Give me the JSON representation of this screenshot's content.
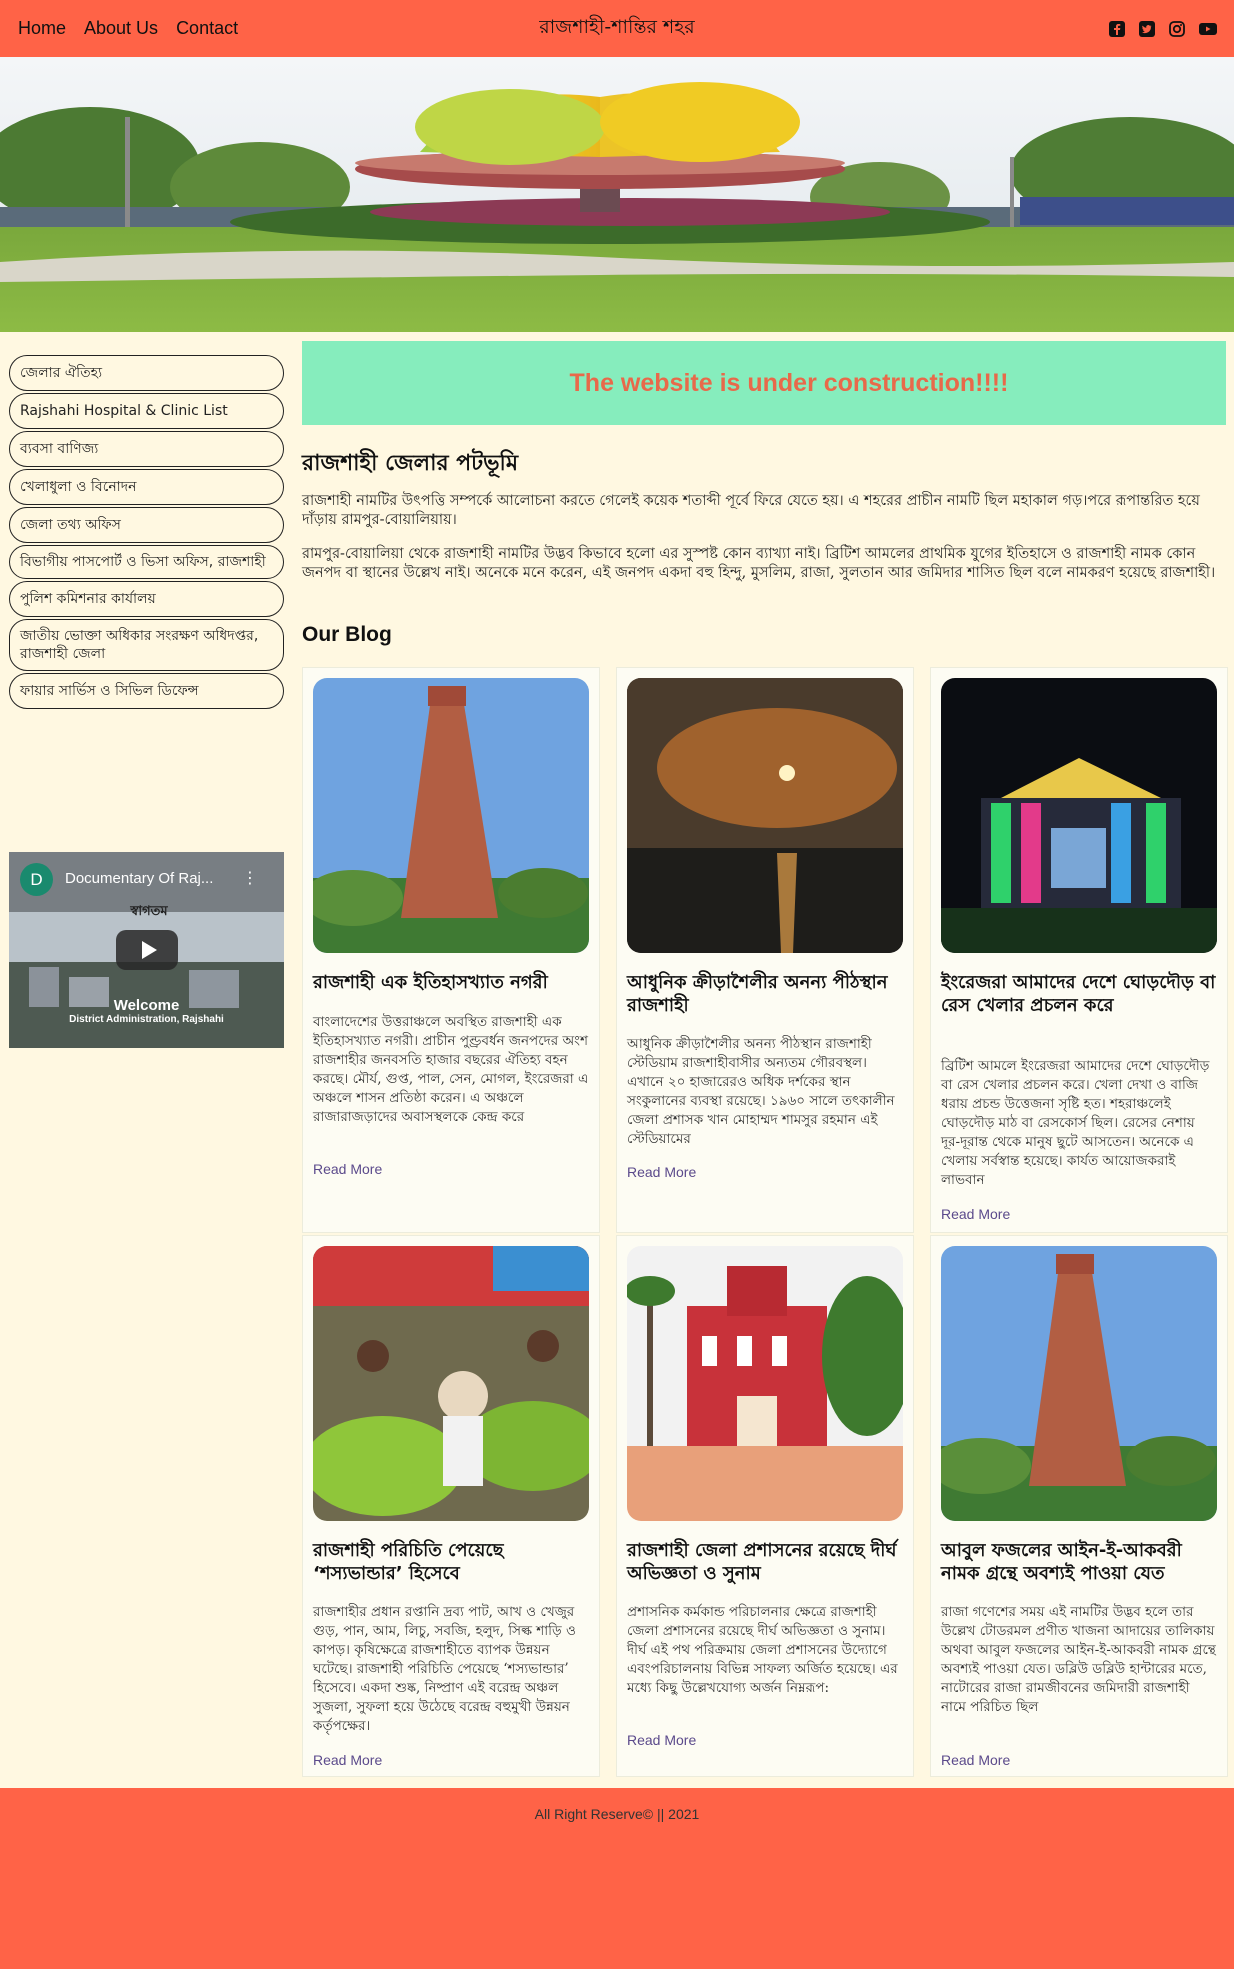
{
  "nav": {
    "links": [
      "Home",
      "About Us",
      "Contact"
    ],
    "site_title": "রাজশাহী-শান্তির শহর",
    "social_icons": [
      "facebook-icon",
      "twitter-icon",
      "instagram-icon",
      "youtube-icon"
    ]
  },
  "sidebar": {
    "items": [
      "জেলার ঐতিহ্য",
      "Rajshahi Hospital & Clinic List",
      "ব্যবসা বাণিজ্য",
      "খেলাধুলা ও বিনোদন",
      "জেলা তথ্য অফিস",
      "বিভাগীয় পাসপোর্ট ও ভিসা অফিস, রাজশাহী",
      "পুলিশ কমিশনার কার্যালয়",
      "জাতীয় ভোক্তা অধিকার সংরক্ষণ অধিদপ্তর, রাজশাহী জেলা",
      "ফায়ার সার্ভিস ও সিভিল ডিফেন্স"
    ],
    "video": {
      "channel_initial": "D",
      "title": "Documentary Of Raj...",
      "logo_text": "স্বাগতম",
      "welcome": "Welcome",
      "subtitle": "District Administration, Rajshahi"
    }
  },
  "main": {
    "banner": "The website is under construction!!!!",
    "section_title": "রাজশাহী জেলার পটভূমি",
    "paragraphs": [
      "রাজশাহী নামটির উৎপত্তি সম্পর্কে আলোচনা করতে গেলেই কয়েক শতাব্দী পূর্বে ফিরে যেতে হয়। এ শহরের প্রাচীন নামটি ছিল মহাকাল গড়।পরে রূপান্তরিত হয়ে দাঁড়ায় রামপুর-বোয়ালিয়ায়।",
      "রামপুর-বোয়ালিয়া থেকে রাজশাহী নামটির উদ্ভব কিভাবে হলো এর সুস্পষ্ট কোন ব্যাখ্যা নাই। ব্রিটিশ আমলের প্রাথমিক যুগের ইতিহাসে ও রাজশাহী নামক কোন জনপদ বা স্থানের উল্লেখ নাই। অনেকে মনে করেন, এই জনপদ একদা বহু হিন্দু, মুসলিম, রাজা, সুলতান আর জমিদার শাসিত ছিল বলে নামকরণ হয়েছে রাজশাহী।"
    ],
    "blog_title": "Our Blog",
    "read_more": "Read More",
    "posts": [
      {
        "title": "রাজশাহী এক ইতিহাসখ্যাত নগরী",
        "text": "বাংলাদেশের উত্তরাঞ্চলে অবস্থিত রাজশাহী এক ইতিহাসখ্যাত নগরী। প্রাচীন পুণ্ড্রবর্ধন জনপদের অংশ রাজশাহীর জনবসতি হাজার বছরের ঐতিহ্য বহন করছে। মৌর্য, গুপ্ত, পাল, সেন, মোগল, ইংরেজরা এ অঞ্চলে শাসন প্রতিষ্ঠা করেন। এ অঞ্চলে রাজারাজড়াদের অবাসস্থলকে কেন্দ্র করে"
      },
      {
        "title": "আধুনিক ক্রীড়াশৈলীর অনন্য পীঠস্থান রাজশাহী",
        "text": "আধুনিক ক্রীড়াশৈলীর অনন্য পীঠস্থান রাজশাহী স্টেডিয়াম রাজশাহীবাসীর অন্যতম গৌরবস্থল। এখানে ২০ হাজারেরও অধিক দর্শকের স্থান সংকুলানের ব্যবস্থা রয়েছে। ১৯৬০ সালে তৎকালীন জেলা প্রশাসক খান মোহাম্মদ শামসুর রহমান এই স্টেডিয়ামের"
      },
      {
        "title": "ইংরেজরা আমাদের দেশে ঘোড়দৌড় বা রেস খেলার প্রচলন করে",
        "text": "ব্রিটিশ আমলে ইংরেজরা আমাদের দেশে ঘোড়দৌড় বা রেস খেলার প্রচলন করে। খেলা দেখা ও বাজি ধরায় প্রচন্ড উত্তেজনা সৃষ্টি হত। শহরাঞ্চলেই ঘোড়দৌড় মাঠ বা রেসকোর্স ছিল। রেসের নেশায় দূর-দূরান্ত থেকে মানুষ ছুটে আসতেন। অনেকে এ খেলায় সর্বস্বান্ত হয়েছে। কার্যত আয়োজকরাই লাভবান"
      },
      {
        "title": "রাজশাহী পরিচিতি পেয়েছে ‘শস্যভান্ডার’ হিসেবে",
        "text": "রাজশাহীর প্রধান রপ্তানি দ্রব্য পাট, আখ ও খেজুর গুড়, পান, আম, লিচু, সবজি, হলুদ, সিল্ক শাড়ি ও কাপড়। কৃষিক্ষেত্রে রাজশাহীতে ব্যাপক উন্নয়ন ঘটেছে। রাজশাহী পরিচিতি পেয়েছে ‘শস্যভান্ডার’ হিসেবে। একদা শুষ্ক, নিষ্প্রাণ এই বরেন্দ্র অঞ্চল সুজলা, সুফলা হয়ে উঠেছে বরেন্দ্র বহুমুখী উন্নয়ন কর্তৃপক্ষের।"
      },
      {
        "title": "রাজশাহী জেলা প্রশাসনের রয়েছে দীর্ঘ অভিজ্ঞতা ও সুনাম",
        "text": "প্রশাসনিক কর্মকান্ড পরিচালনার ক্ষেত্রে রাজশাহী জেলা প্রশাসনের রয়েছে দীর্ঘ অভিজ্ঞতা ও সুনাম। দীর্ঘ এই পথ পরিক্রমায় জেলা প্রশাসনের উদ্যোগে এবংপরিচালনায় বিভিন্ন সাফল্য অর্জিত হয়েছে। এর মধ্যে কিছু উল্লেখযোগ্য অর্জন নিম্নরূপ:"
      },
      {
        "title": "আবুল ফজলের আইন-ই-আকবরী নামক গ্রন্থে অবশ্যই পাওয়া যেত",
        "text": "রাজা গণেশের সময় এই নামটির উদ্ভব হলে তার উল্লেখ টোডরমল প্রণীত খাজনা আদায়ের তালিকায় অথবা আবুল ফজলের আইন-ই-আকবরী নামক গ্রন্থে অবশ্যই পাওয়া যেত। ডব্লিউ ডব্লিউ হান্টারের মতে, নাটোরের রাজা রামজীবনের জমিদারী রাজশাহী নামে পরিচিত ছিল"
      }
    ]
  },
  "footer": {
    "text": "All Right Reserve© || 2021"
  },
  "colors": {
    "nav": "#ff6347",
    "banner": "#86edbd",
    "banner_text": "#e8694a",
    "page_bg": "#fff8e1"
  }
}
